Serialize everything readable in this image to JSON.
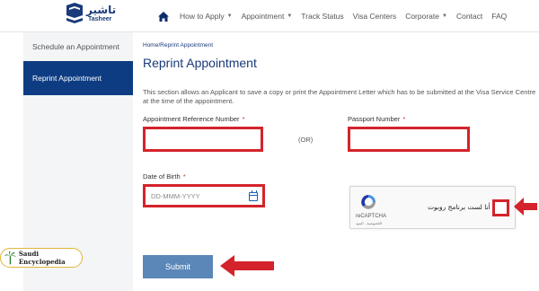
{
  "brand": {
    "name_ar": "تاشير",
    "name_en": "Tasheer"
  },
  "nav": {
    "items": [
      {
        "label": "How to Apply",
        "dropdown": true
      },
      {
        "label": "Appointment",
        "dropdown": true
      },
      {
        "label": "Track Status",
        "dropdown": false
      },
      {
        "label": "Visa Centers",
        "dropdown": false
      },
      {
        "label": "Corporate",
        "dropdown": true
      },
      {
        "label": "Contact",
        "dropdown": false
      },
      {
        "label": "FAQ",
        "dropdown": false
      }
    ]
  },
  "sidebar": {
    "items": [
      {
        "label": "Schedule an Appointment",
        "active": false
      },
      {
        "label": "Reprint Appointment",
        "active": true
      }
    ]
  },
  "main": {
    "breadcrumb": "Home/Reprint Appointment",
    "title": "Reprint Appointment",
    "description": "This section allows an Applicant to save a copy or print the Appointment Letter which has to be submitted at the Visa Service Centre at the time of the appointment."
  },
  "form": {
    "ref_label": "Appointment Reference Number",
    "ref_value": "",
    "or_text": "(OR)",
    "passport_label": "Passport Number",
    "passport_value": "",
    "dob_label": "Date of Birth",
    "dob_placeholder": "DD-MMM-YYYY",
    "required_mark": "*",
    "submit_label": "Submit"
  },
  "captcha": {
    "text": "أنا لست برنامج روبوت",
    "brand": "reCAPTCHA",
    "terms": "الخصوصية - البنود"
  },
  "watermark": {
    "text": "Saudi Encyclopedia"
  },
  "colors": {
    "primary": "#0d3c82",
    "highlight": "#d4232b",
    "button": "#5b87b8",
    "sidebar_bg": "#f4f5f7"
  },
  "icons": [
    "home-icon",
    "chevron-down-icon",
    "calendar-icon",
    "recaptcha-icon",
    "arrow-left-icon",
    "palm-tree-icon"
  ]
}
